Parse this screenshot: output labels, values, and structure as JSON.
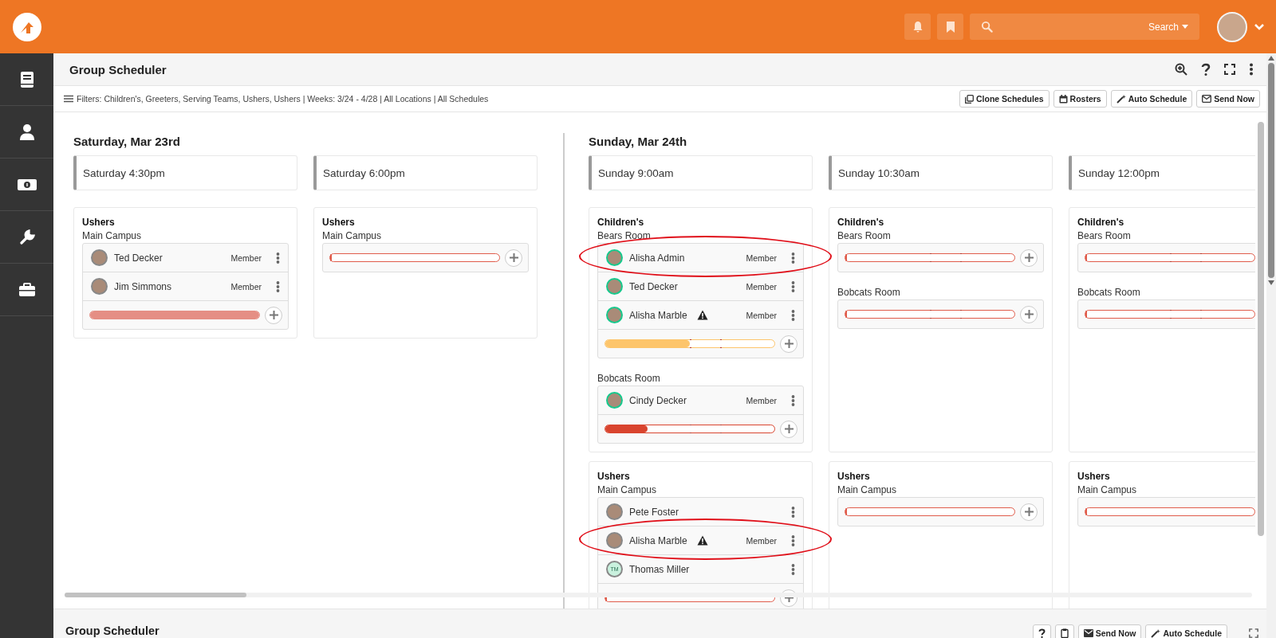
{
  "app_bar": {
    "search_type": "Search"
  },
  "sidebar": {
    "items": [
      {
        "kind": "book"
      },
      {
        "kind": "person"
      },
      {
        "kind": "money"
      },
      {
        "kind": "wrench"
      },
      {
        "kind": "briefcase"
      }
    ]
  },
  "block": {
    "title": "Group Scheduler",
    "filters": "Filters: Children's, Greeters, Serving Teams, Ushers, Ushers | Weeks: 3/24 - 4/28 | All Locations | All Schedules",
    "actions": [
      {
        "label": "Clone Schedules",
        "kind": "clone"
      },
      {
        "label": "Rosters",
        "kind": "calendar"
      },
      {
        "label": "Auto Schedule",
        "kind": "wand"
      },
      {
        "label": "Send Now",
        "kind": "email"
      }
    ]
  },
  "days": [
    {
      "title": "Saturday, Mar 23rd",
      "schedules": [
        {
          "title": "Saturday 4:30pm",
          "groups": [
            {
              "name": "Ushers",
              "locations": [
                {
                  "name": "Main Campus",
                  "members": [
                    {
                      "name": "Ted Decker",
                      "role": "Member",
                      "kind": "photo",
                      "color": "#888888",
                      "warning": false,
                      "circled": false
                    },
                    {
                      "name": "Jim Simmons",
                      "role": "Member",
                      "kind": "photo",
                      "color": "#888888",
                      "warning": false,
                      "circled": false
                    }
                  ],
                  "bar": {
                    "level": 1,
                    "color": "#e58e84",
                    "targets": false
                  }
                }
              ]
            }
          ]
        },
        {
          "title": "Saturday 6:00pm",
          "groups": [
            {
              "name": "Ushers",
              "locations": [
                {
                  "name": "Main Campus",
                  "bar": {
                    "level": 0,
                    "color": "#e05b4a",
                    "targets": false
                  }
                }
              ]
            }
          ]
        }
      ]
    },
    {
      "title": "Sunday, Mar 24th",
      "schedules": [
        {
          "title": "Sunday 9:00am",
          "groups": [
            {
              "name": "Children's",
              "locations": [
                {
                  "name": "Bears Room",
                  "members": [
                    {
                      "name": "Alisha Admin",
                      "role": "Member",
                      "kind": "photo",
                      "color": "#16c98d",
                      "warning": false,
                      "circled": true
                    },
                    {
                      "name": "Ted Decker",
                      "role": "Member",
                      "kind": "photo",
                      "color": "#16c98d",
                      "warning": false,
                      "circled": false
                    },
                    {
                      "name": "Alisha Marble",
                      "role": "Member",
                      "kind": "photo",
                      "color": "#16c98d",
                      "warning": true,
                      "circled": false
                    }
                  ],
                  "bar": {
                    "level": 0.5,
                    "color": "#fdc56b",
                    "targets": true
                  }
                },
                {
                  "name": "Bobcats Room",
                  "members": [
                    {
                      "name": "Cindy Decker",
                      "role": "Member",
                      "kind": "photo",
                      "color": "#16c98d",
                      "warning": false,
                      "circled": false
                    }
                  ],
                  "bar": {
                    "level": 0.25,
                    "color": "#d9442e",
                    "targets": true
                  }
                }
              ]
            },
            {
              "name": "Ushers",
              "locations": [
                {
                  "name": "Main Campus",
                  "members": [
                    {
                      "name": "Pete Foster",
                      "kind": "photo",
                      "color": "#888888",
                      "warning": false,
                      "circled": false
                    },
                    {
                      "name": "Alisha Marble",
                      "role": "Member",
                      "kind": "photo",
                      "color": "#888888",
                      "warning": true,
                      "circled": true
                    },
                    {
                      "name": "Thomas Miller",
                      "kind": "initials",
                      "initials": "TM",
                      "color": "#888888",
                      "warning": false,
                      "circled": false
                    }
                  ],
                  "bar": {
                    "level": 0,
                    "color": "#e05b4a",
                    "targets": false
                  }
                }
              ]
            }
          ]
        },
        {
          "title": "Sunday 10:30am",
          "groups": [
            {
              "name": "Children's",
              "locations": [
                {
                  "name": "Bears Room",
                  "bar": {
                    "level": 0,
                    "color": "#e05b4a",
                    "targets": true
                  }
                },
                {
                  "name": "Bobcats Room",
                  "bar": {
                    "level": 0,
                    "color": "#e05b4a",
                    "targets": true
                  }
                }
              ]
            },
            {
              "name": "Ushers",
              "locations": [
                {
                  "name": "Main Campus",
                  "bar": {
                    "level": 0,
                    "color": "#e05b4a",
                    "targets": false
                  }
                }
              ]
            }
          ]
        },
        {
          "title": "Sunday 12:00pm",
          "groups": [
            {
              "name": "Children's",
              "locations": [
                {
                  "name": "Bears Room",
                  "bar": {
                    "level": 0,
                    "color": "#e05b4a",
                    "targets": true
                  }
                },
                {
                  "name": "Bobcats Room",
                  "bar": {
                    "level": 0,
                    "color": "#e05b4a",
                    "targets": true
                  }
                }
              ]
            },
            {
              "name": "Ushers",
              "locations": [
                {
                  "name": "Main Campus",
                  "bar": {
                    "level": 0,
                    "color": "#e05b4a",
                    "targets": false
                  }
                }
              ]
            }
          ]
        }
      ]
    }
  ],
  "footer_block": {
    "title": "Group Scheduler",
    "actions": [
      {
        "kind": "help"
      },
      {
        "kind": "clipboard"
      },
      {
        "label": "Send Now",
        "kind": "email"
      },
      {
        "label": "Auto Schedule",
        "kind": "wand"
      }
    ]
  }
}
